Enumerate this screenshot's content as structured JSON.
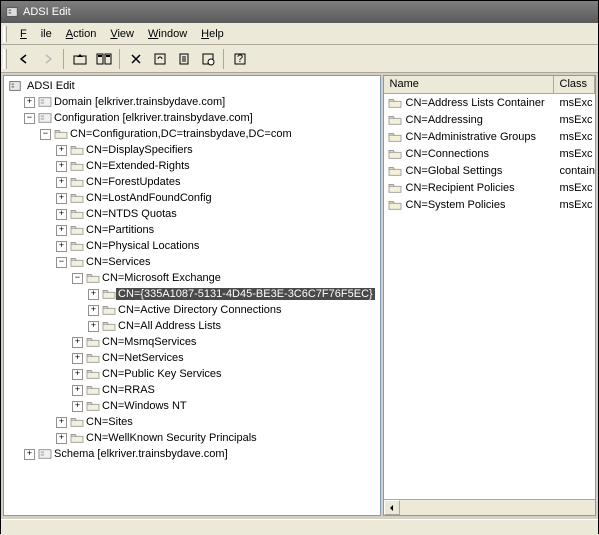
{
  "title": "ADSI Edit",
  "menu": {
    "file": "File",
    "action": "Action",
    "view": "View",
    "window": "Window",
    "help": "Help"
  },
  "rootLabel": "ADSI Edit",
  "tree": [
    {
      "level": 1,
      "exp": "+",
      "icon": "container",
      "label": "Domain [elkriver.trainsbydave.com]"
    },
    {
      "level": 1,
      "exp": "-",
      "icon": "container",
      "label": "Configuration [elkriver.trainsbydave.com]"
    },
    {
      "level": 2,
      "exp": "-",
      "icon": "folder",
      "label": "CN=Configuration,DC=trainsbydave,DC=com"
    },
    {
      "level": 3,
      "exp": "+",
      "icon": "folder",
      "label": "CN=DisplaySpecifiers"
    },
    {
      "level": 3,
      "exp": "+",
      "icon": "folder",
      "label": "CN=Extended-Rights"
    },
    {
      "level": 3,
      "exp": "+",
      "icon": "folder",
      "label": "CN=ForestUpdates"
    },
    {
      "level": 3,
      "exp": "+",
      "icon": "folder",
      "label": "CN=LostAndFoundConfig"
    },
    {
      "level": 3,
      "exp": "+",
      "icon": "folder",
      "label": "CN=NTDS Quotas"
    },
    {
      "level": 3,
      "exp": "+",
      "icon": "folder",
      "label": "CN=Partitions"
    },
    {
      "level": 3,
      "exp": "+",
      "icon": "folder",
      "label": "CN=Physical Locations"
    },
    {
      "level": 3,
      "exp": "-",
      "icon": "folder",
      "label": "CN=Services"
    },
    {
      "level": 4,
      "exp": "-",
      "icon": "folder",
      "label": "CN=Microsoft Exchange"
    },
    {
      "level": 5,
      "exp": "+",
      "icon": "folder",
      "label": "CN={335A1087-5131-4D45-BE3E-3C6C7F76F5EC}",
      "selected": true
    },
    {
      "level": 5,
      "exp": "+",
      "icon": "folder",
      "label": "CN=Active Directory Connections"
    },
    {
      "level": 5,
      "exp": "+",
      "icon": "folder",
      "label": "CN=All Address Lists"
    },
    {
      "level": 4,
      "exp": "+",
      "icon": "folder",
      "label": "CN=MsmqServices"
    },
    {
      "level": 4,
      "exp": "+",
      "icon": "folder",
      "label": "CN=NetServices"
    },
    {
      "level": 4,
      "exp": "+",
      "icon": "folder",
      "label": "CN=Public Key Services"
    },
    {
      "level": 4,
      "exp": "+",
      "icon": "folder",
      "label": "CN=RRAS"
    },
    {
      "level": 4,
      "exp": "+",
      "icon": "folder",
      "label": "CN=Windows NT"
    },
    {
      "level": 3,
      "exp": "+",
      "icon": "folder",
      "label": "CN=Sites"
    },
    {
      "level": 3,
      "exp": "+",
      "icon": "folder",
      "label": "CN=WellKnown Security Principals"
    },
    {
      "level": 1,
      "exp": "+",
      "icon": "container",
      "label": "Schema [elkriver.trainsbydave.com]"
    }
  ],
  "columns": {
    "name": "Name",
    "class": "Class"
  },
  "rows": [
    {
      "name": "CN=Address Lists Container",
      "class": "msExc"
    },
    {
      "name": "CN=Addressing",
      "class": "msExc"
    },
    {
      "name": "CN=Administrative Groups",
      "class": "msExc"
    },
    {
      "name": "CN=Connections",
      "class": "msExc"
    },
    {
      "name": "CN=Global Settings",
      "class": "contain"
    },
    {
      "name": "CN=Recipient Policies",
      "class": "msExc"
    },
    {
      "name": "CN=System Policies",
      "class": "msExc"
    }
  ]
}
